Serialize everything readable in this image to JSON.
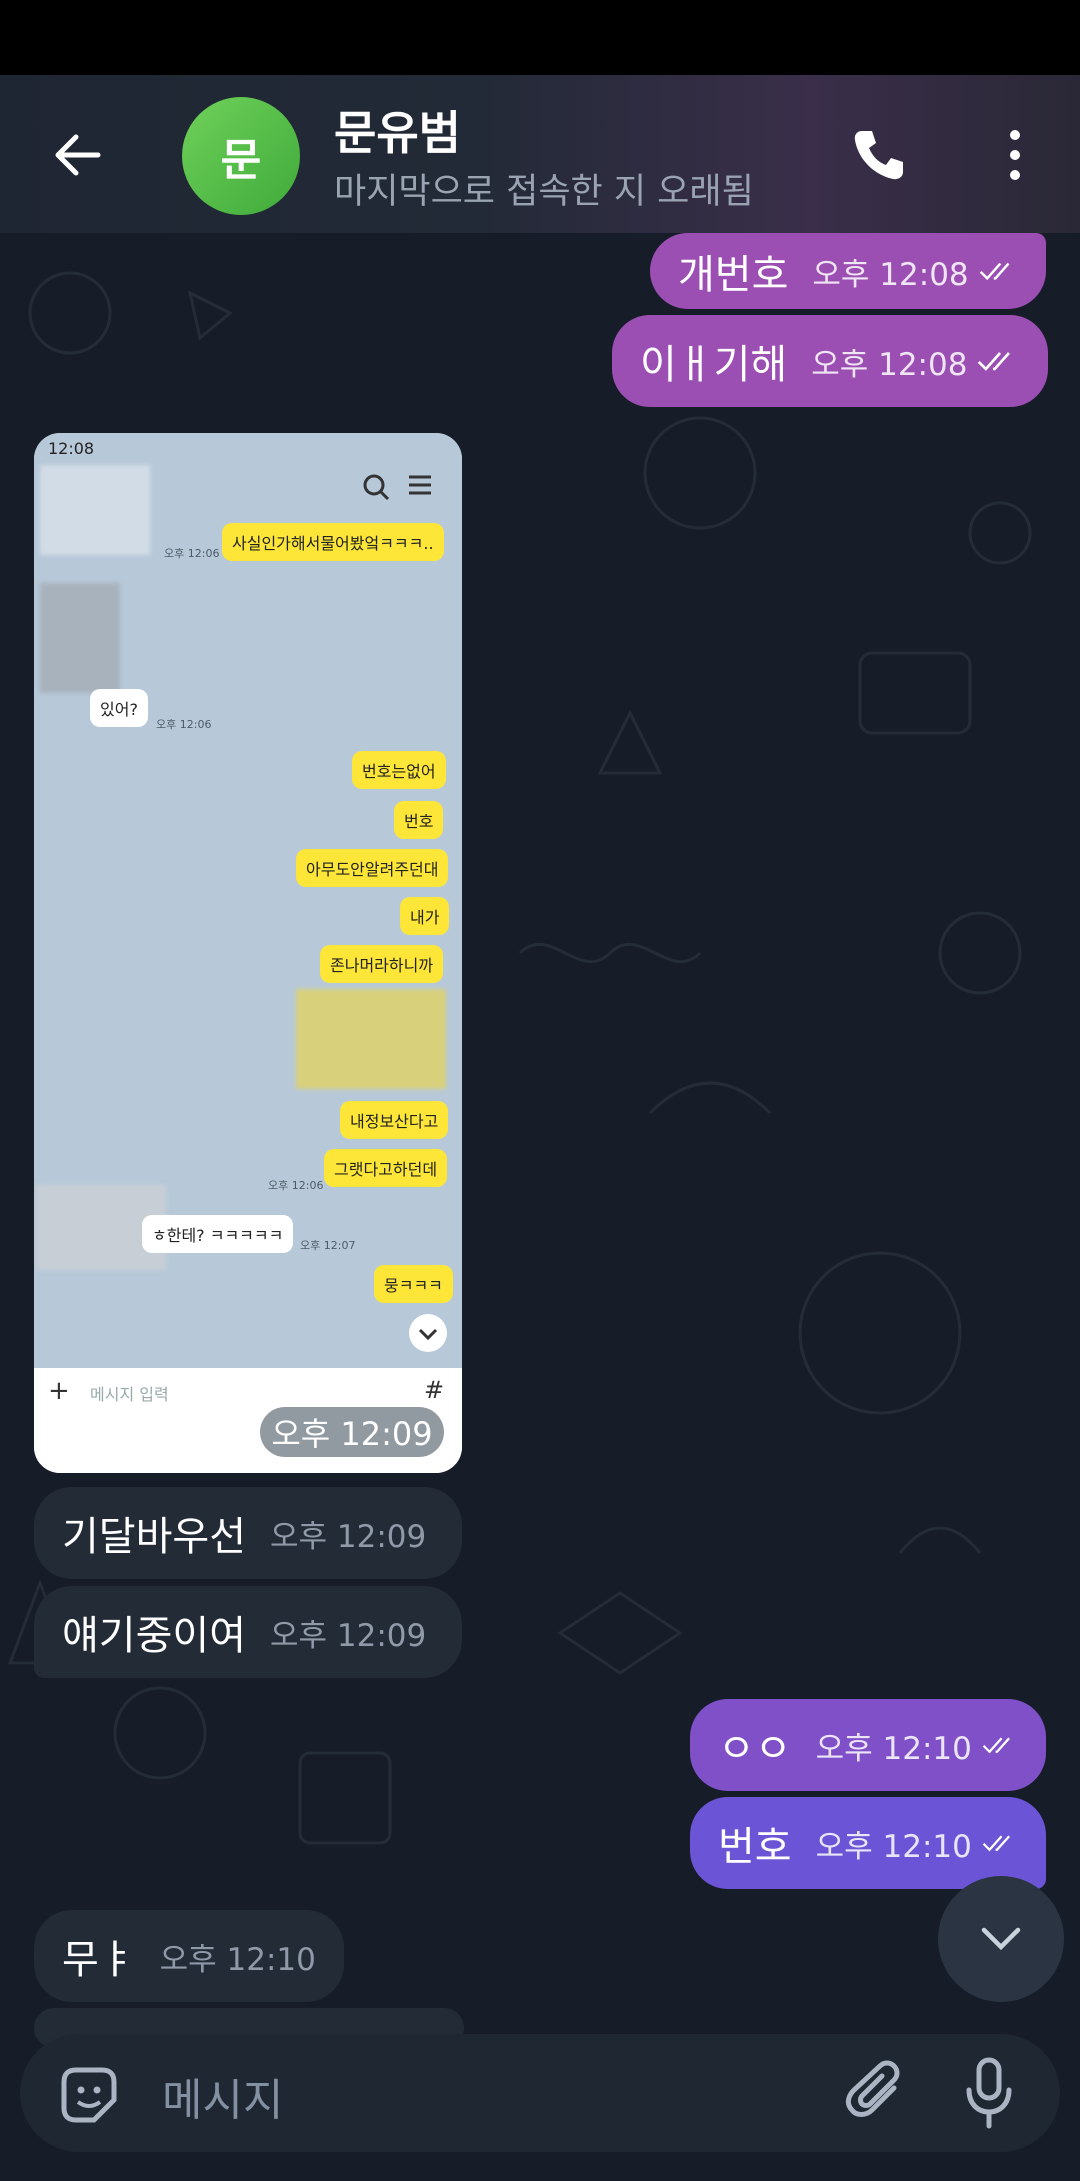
{
  "header": {
    "avatar_letter": "문",
    "name": "문유범",
    "status": "마지막으로 접속한 지 오래됨"
  },
  "messages": [
    {
      "text": "개번호",
      "time": "오후 12:08",
      "dir": "out"
    },
    {
      "text": "이ㅐ기해",
      "time": "오후 12:08",
      "dir": "out"
    },
    {
      "text": "기달바우선",
      "time": "오후 12:09",
      "dir": "in"
    },
    {
      "text": "얘기중이여",
      "time": "오후 12:09",
      "dir": "in"
    },
    {
      "text": "ㅇㅇ",
      "time": "오후 12:10",
      "dir": "out"
    },
    {
      "text": "번호",
      "time": "오후 12:10",
      "dir": "out"
    },
    {
      "text": "무ㅑ",
      "time": "오후 12:10",
      "dir": "in"
    }
  ],
  "shared_image": {
    "time": "오후 12:09",
    "status_time": "12:08",
    "input_placeholder": "메시지 입력",
    "bubbles": [
      {
        "text": "사실인가해서물어봤엌ㅋㅋㅋ..",
        "side": "right"
      },
      {
        "text": "있어?",
        "side": "left"
      },
      {
        "text": "번호는없어",
        "side": "right"
      },
      {
        "text": "번호",
        "side": "right"
      },
      {
        "text": "아무도안알려주던대",
        "side": "right"
      },
      {
        "text": "내가",
        "side": "right"
      },
      {
        "text": "존나머라하니까",
        "side": "right"
      },
      {
        "text": "내정보산다고",
        "side": "right"
      },
      {
        "text": "그랫다고하던데",
        "side": "right"
      },
      {
        "text": "ㅎ한테? ㅋㅋㅋㅋㅋ",
        "side": "left"
      },
      {
        "text": "뭉ㅋㅋㅋ",
        "side": "right"
      }
    ],
    "stamps": [
      "오후 12:06",
      "오후 12:06",
      "오후 12:06",
      "오후 12:07"
    ]
  },
  "composer": {
    "placeholder": "메시지"
  },
  "colors": {
    "background": "#161d28",
    "outgoing_purple": "#9c4fb3",
    "outgoing_violet": "#6b55d6",
    "incoming": "#232b37",
    "avatar_green": "#4cbb44"
  },
  "icons": [
    "back-arrow-icon",
    "phone-icon",
    "more-vert-icon",
    "double-check-icon",
    "chevron-down-icon",
    "sticker-icon",
    "paperclip-icon",
    "microphone-icon"
  ]
}
